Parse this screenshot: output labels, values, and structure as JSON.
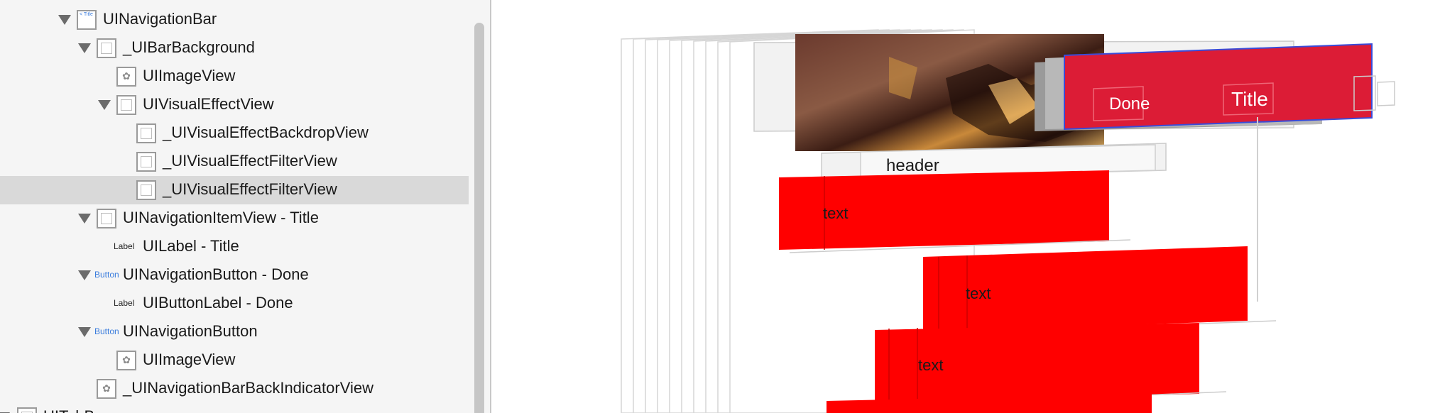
{
  "outline": {
    "items": [
      {
        "label": "UINavigationBar",
        "icon": "navigation-bar-icon",
        "badge": ""
      },
      {
        "label": "_UIBarBackground",
        "icon": "view-icon",
        "badge": ""
      },
      {
        "label": "UIImageView",
        "icon": "image-view-icon",
        "badge": ""
      },
      {
        "label": "UIVisualEffectView",
        "icon": "view-icon",
        "badge": ""
      },
      {
        "label": "_UIVisualEffectBackdropView",
        "icon": "view-icon",
        "badge": ""
      },
      {
        "label": "_UIVisualEffectFilterView",
        "icon": "view-icon",
        "badge": ""
      },
      {
        "label": "_UIVisualEffectFilterView",
        "icon": "view-icon",
        "badge": ""
      },
      {
        "label": "UINavigationItemView - Title",
        "icon": "view-icon",
        "badge": ""
      },
      {
        "label": "UILabel - Title",
        "icon": "label-icon",
        "badge": "Label"
      },
      {
        "label": "UINavigationButton - Done",
        "icon": "button-icon",
        "badge": "Button"
      },
      {
        "label": "UIButtonLabel - Done",
        "icon": "label-icon",
        "badge": "Label"
      },
      {
        "label": "UINavigationButton",
        "icon": "button-icon",
        "badge": "Button"
      },
      {
        "label": "UIImageView",
        "icon": "image-view-icon",
        "badge": ""
      },
      {
        "label": "_UINavigationBarBackIndicatorView",
        "icon": "image-view-icon",
        "badge": ""
      },
      {
        "label": "UITabBar",
        "icon": "view-icon",
        "badge": ""
      }
    ],
    "nav_icon_text": "< Title"
  },
  "canvas": {
    "done_label": "Done",
    "title_label": "Title",
    "header_label": "header",
    "cell1_text": "text",
    "cell2_text": "text",
    "cell3_text": "text"
  },
  "colors": {
    "accent_red": "#ff0000",
    "nav_bar_red": "#dc1c36",
    "selection": "#d9d9d9",
    "sidebar_bg": "#f5f5f5"
  }
}
